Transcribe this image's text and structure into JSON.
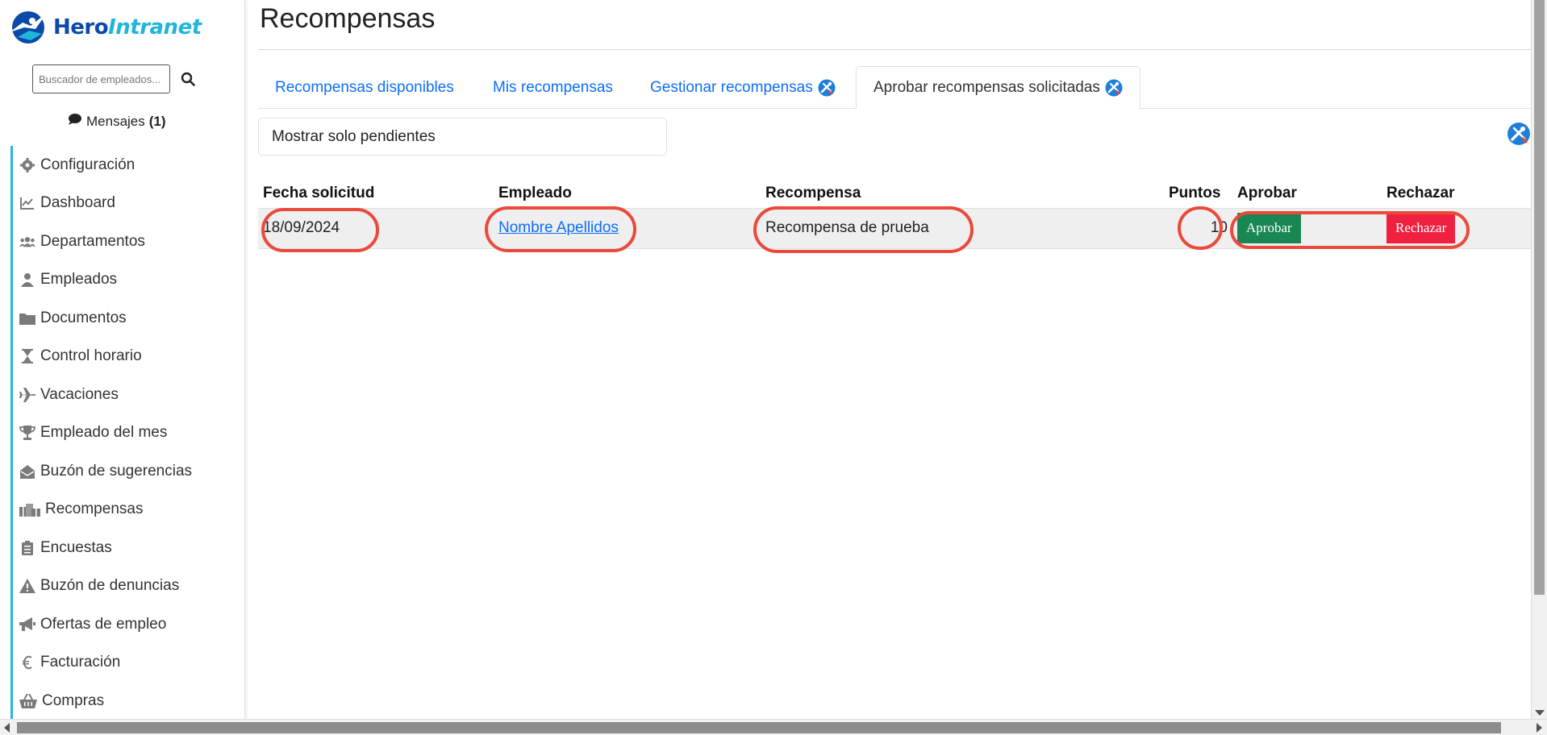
{
  "brand": {
    "name_part1": "Hero",
    "name_part2": "Intranet"
  },
  "search": {
    "placeholder": "Buscador de empleados..."
  },
  "messages": {
    "label": "Mensajes",
    "count": "(1)"
  },
  "sidebar": {
    "items": [
      {
        "label": "Configuración",
        "icon": "gear-icon"
      },
      {
        "label": "Dashboard",
        "icon": "chart-line-icon"
      },
      {
        "label": "Departamentos",
        "icon": "users-icon"
      },
      {
        "label": "Empleados",
        "icon": "user-icon"
      },
      {
        "label": "Documentos",
        "icon": "folder-icon"
      },
      {
        "label": "Control horario",
        "icon": "hourglass-icon"
      },
      {
        "label": "Vacaciones",
        "icon": "plane-icon"
      },
      {
        "label": "Empleado del mes",
        "icon": "trophy-icon"
      },
      {
        "label": "Buzón de sugerencias",
        "icon": "envelope-open-icon"
      },
      {
        "label": "Recompensas",
        "icon": "gifts-icon"
      },
      {
        "label": "Encuestas",
        "icon": "clipboard-list-icon"
      },
      {
        "label": "Buzón de denuncias",
        "icon": "warning-icon"
      },
      {
        "label": "Ofertas de empleo",
        "icon": "megaphone-icon"
      },
      {
        "label": "Facturación",
        "icon": "euro-icon"
      },
      {
        "label": "Compras",
        "icon": "basket-icon"
      }
    ]
  },
  "page": {
    "title": "Recompensas"
  },
  "tabs": [
    {
      "label": "Recompensas disponibles"
    },
    {
      "label": "Mis recompensas"
    },
    {
      "label": "Gestionar recompensas"
    },
    {
      "label": "Aprobar recompensas solicitadas"
    }
  ],
  "filter": {
    "label": "Mostrar solo pendientes"
  },
  "table": {
    "headers": [
      "Fecha solicitud",
      "Empleado",
      "Recompensa",
      "Puntos",
      "Aprobar",
      "Rechazar"
    ],
    "rows": [
      {
        "fecha": "18/09/2024",
        "empleado": "Nombre Apellidos",
        "recompensa": "Recompensa de prueba",
        "puntos": "10",
        "aprobar": "Aprobar",
        "rechazar": "Rechazar"
      }
    ]
  },
  "colors": {
    "brand": "#0b4aa8",
    "accent": "#27b5d8",
    "link": "#0d6efd",
    "approve": "#198754",
    "reject": "#f0213f",
    "annotation": "#ea4a3c"
  }
}
